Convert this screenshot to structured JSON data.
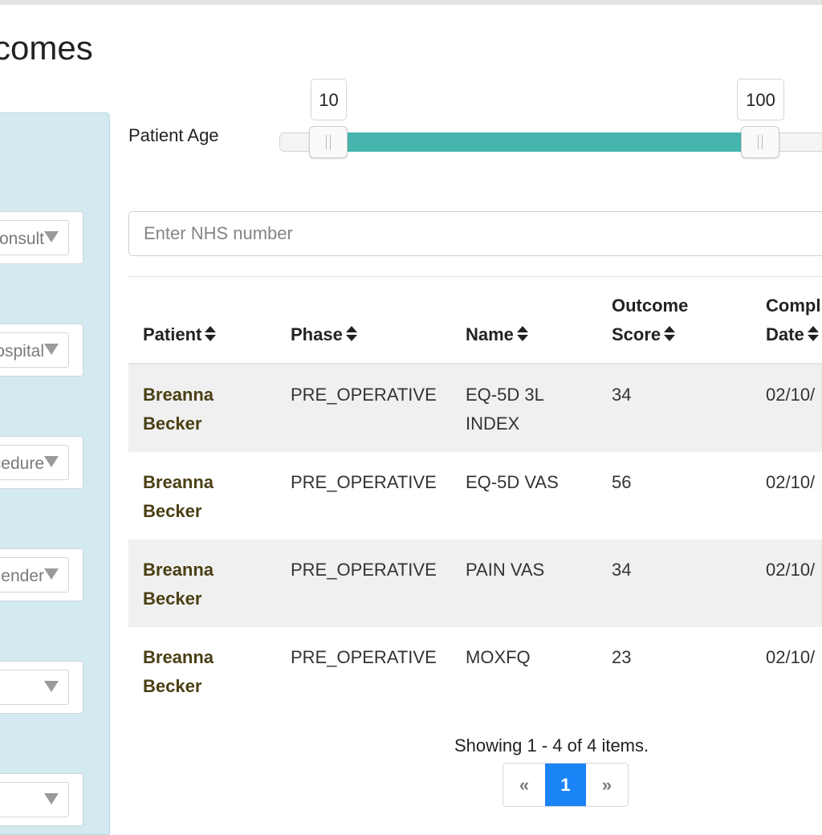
{
  "page": {
    "title": "comes"
  },
  "sidebar": {
    "filters": [
      {
        "value": "Consult"
      },
      {
        "value": "Hospital"
      },
      {
        "value": "Procedure"
      },
      {
        "value": "Gender"
      },
      {
        "value": ""
      },
      {
        "value": ""
      }
    ]
  },
  "age_filter": {
    "label": "Patient Age",
    "min": 10,
    "max": 100,
    "low_label": "10",
    "high_label": "100",
    "accent": "#45b5ad"
  },
  "search": {
    "placeholder": "Enter NHS number",
    "value": ""
  },
  "table": {
    "columns": [
      {
        "line1": "",
        "line2": "Patient"
      },
      {
        "line1": "",
        "line2": "Phase"
      },
      {
        "line1": "",
        "line2": "Name"
      },
      {
        "line1": "Outcome",
        "line2": "Score"
      },
      {
        "line1": "Compl",
        "line2": "Date"
      }
    ],
    "rows": [
      {
        "patient_first": "Breanna",
        "patient_last": "Becker",
        "phase": "PRE_OPERATIVE",
        "name_line1": "EQ-5D 3L",
        "name_line2": "INDEX",
        "score": "34",
        "date": "02/10/"
      },
      {
        "patient_first": "Breanna",
        "patient_last": "Becker",
        "phase": "PRE_OPERATIVE",
        "name_line1": "EQ-5D VAS",
        "name_line2": "",
        "score": "56",
        "date": "02/10/"
      },
      {
        "patient_first": "Breanna",
        "patient_last": "Becker",
        "phase": "PRE_OPERATIVE",
        "name_line1": "PAIN VAS",
        "name_line2": "",
        "score": "34",
        "date": "02/10/"
      },
      {
        "patient_first": "Breanna",
        "patient_last": "Becker",
        "phase": "PRE_OPERATIVE",
        "name_line1": "MOXFQ",
        "name_line2": "",
        "score": "23",
        "date": "02/10/"
      }
    ]
  },
  "pagination": {
    "summary": "Showing 1 - 4 of 4 items.",
    "prev": "«",
    "current": "1",
    "next": "»",
    "active_color": "#1a84f7"
  }
}
